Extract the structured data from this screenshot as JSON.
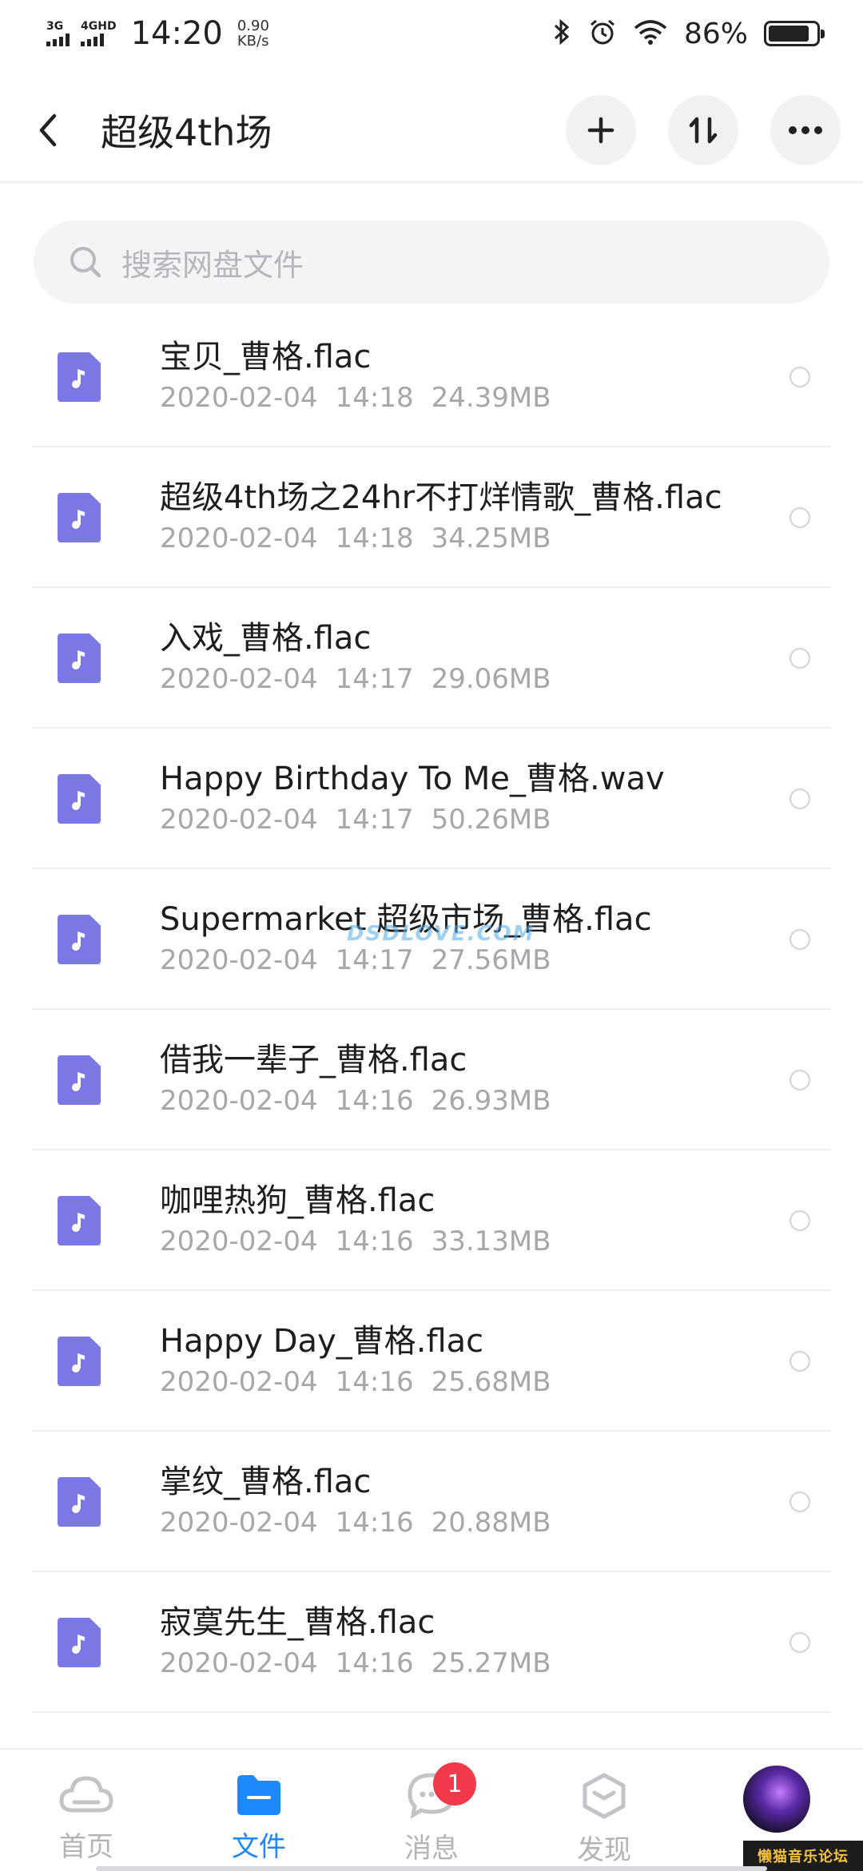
{
  "status_bar": {
    "net1": "3G",
    "net2": "4GHD",
    "time": "14:20",
    "speed_value": "0.90",
    "speed_unit": "KB/s",
    "battery": "86%",
    "battery_level": 0.86
  },
  "header": {
    "title": "超级4th场",
    "icons": [
      "back-icon",
      "plus-icon",
      "sort-icon",
      "more-icon"
    ]
  },
  "search": {
    "placeholder": "搜索网盘文件"
  },
  "files": [
    {
      "name": "宝贝_曹格.flac",
      "date": "2020-02-04",
      "time": "14:18",
      "size": "24.39MB"
    },
    {
      "name": "超级4th场之24hr不打烊情歌_曹格.flac",
      "date": "2020-02-04",
      "time": "14:18",
      "size": "34.25MB"
    },
    {
      "name": "入戏_曹格.flac",
      "date": "2020-02-04",
      "time": "14:17",
      "size": "29.06MB"
    },
    {
      "name": "Happy Birthday To Me_曹格.wav",
      "date": "2020-02-04",
      "time": "14:17",
      "size": "50.26MB"
    },
    {
      "name": "Supermarket 超级市场_曹格.flac",
      "date": "2020-02-04",
      "time": "14:17",
      "size": "27.56MB"
    },
    {
      "name": "借我一辈子_曹格.flac",
      "date": "2020-02-04",
      "time": "14:16",
      "size": "26.93MB"
    },
    {
      "name": "咖哩热狗_曹格.flac",
      "date": "2020-02-04",
      "time": "14:16",
      "size": "33.13MB"
    },
    {
      "name": "Happy Day_曹格.flac",
      "date": "2020-02-04",
      "time": "14:16",
      "size": "25.68MB"
    },
    {
      "name": "掌纹_曹格.flac",
      "date": "2020-02-04",
      "time": "14:16",
      "size": "20.88MB"
    },
    {
      "name": "寂寞先生_曹格.flac",
      "date": "2020-02-04",
      "time": "14:16",
      "size": "25.27MB"
    }
  ],
  "watermark": "DSDLOVE.COM",
  "bottom_nav": {
    "tabs": [
      {
        "label": "首页",
        "icon": "cloud-icon"
      },
      {
        "label": "文件",
        "icon": "folder-icon"
      },
      {
        "label": "消息",
        "icon": "chat-icon",
        "badge": "1"
      },
      {
        "label": "发现",
        "icon": "discover-icon"
      }
    ],
    "forum_badge": "懒猫音乐论坛",
    "active_color": "#1e88ff"
  },
  "colors": {
    "file_icon": "#7b78e6",
    "accent": "#1e88ff",
    "badge": "#f2394a"
  }
}
